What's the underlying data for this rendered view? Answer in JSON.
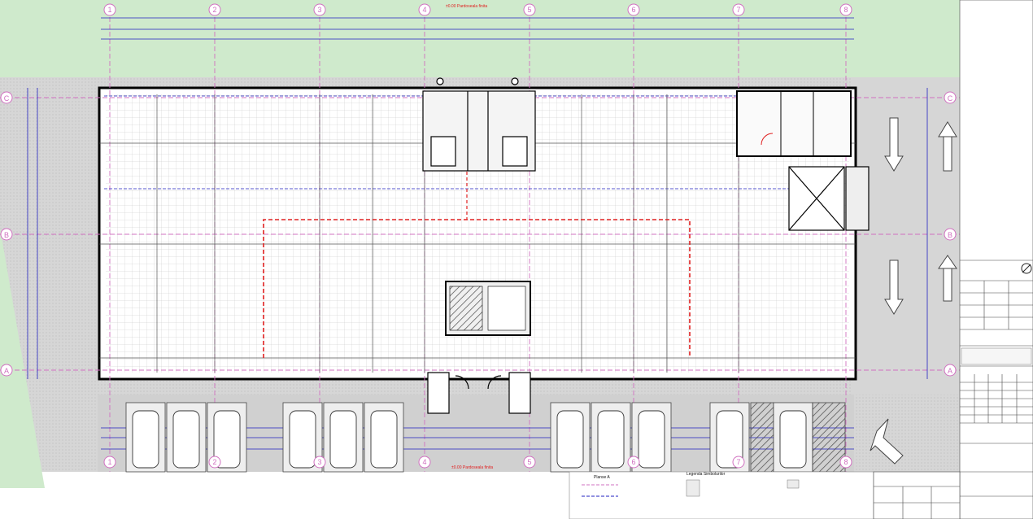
{
  "grid_axes": {
    "columns": [
      "1",
      "2",
      "3",
      "4",
      "5",
      "6",
      "7",
      "8"
    ],
    "rows": [
      "A",
      "B",
      "C"
    ]
  },
  "levels": {
    "top": "±0.00 Pardoseala finita",
    "bottom": "±0.00 Pardoseala finita"
  },
  "legend": {
    "plans_title": "Planse A",
    "symbols_title": "Legenda Simbolurilor"
  },
  "colors": {
    "grass": "#cfeacc",
    "paving": "#d9d9d9",
    "axis": "#d070c0",
    "dimension": "#2020c0",
    "evacuation": "#e02020",
    "wall": "#000000"
  }
}
